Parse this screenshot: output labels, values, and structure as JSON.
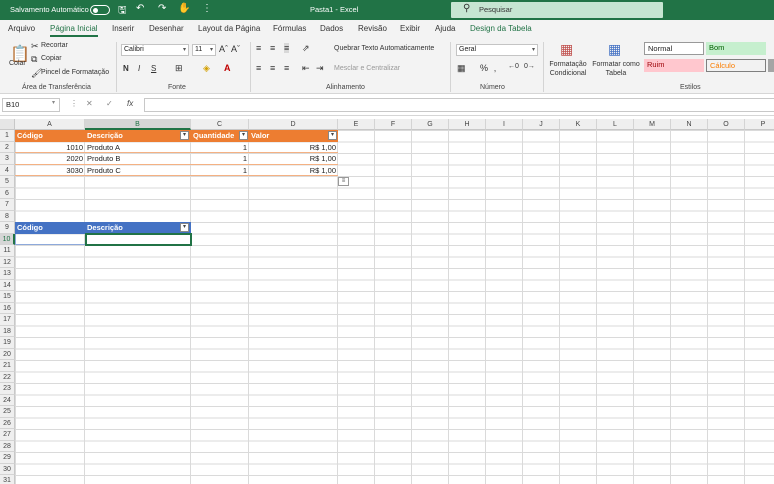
{
  "titlebar": {
    "autosave_label": "Salvamento Automático",
    "doc_title": "Pasta1  -  Excel",
    "search_placeholder": "Pesquisar",
    "accent": "#217346"
  },
  "tabs": [
    "Arquivo",
    "Página Inicial",
    "Inserir",
    "Desenhar",
    "Layout da Página",
    "Fórmulas",
    "Dados",
    "Revisão",
    "Exibir",
    "Ajuda",
    "Design da Tabela"
  ],
  "active_tab": "Página Inicial",
  "ribbon": {
    "clipboard": {
      "paste": "Colar",
      "cut": "Recortar",
      "copy": "Copiar",
      "format_painter": "Pincel de Formatação",
      "label": "Área de Transferência"
    },
    "font": {
      "name": "Calibri",
      "size": "11",
      "bold": "N",
      "italic": "I",
      "underline": "S",
      "label": "Fonte"
    },
    "alignment": {
      "wrap": "Quebrar Texto Automaticamente",
      "merge": "Mesclar e Centralizar",
      "label": "Alinhamento"
    },
    "number": {
      "format": "Geral",
      "percent": "%",
      "label": "Número"
    },
    "styles": {
      "conditional": "Formatação Condicional",
      "as_table": "Formatar como Tabela",
      "normal": "Normal",
      "bom": "Bom",
      "ruim": "Ruim",
      "calculo": "Cálculo",
      "label": "Estilos"
    }
  },
  "formula_bar": {
    "name_box": "B10",
    "fx": "fx",
    "value": ""
  },
  "columns": [
    "A",
    "B",
    "C",
    "D",
    "E",
    "F",
    "G",
    "H",
    "I",
    "J",
    "K",
    "L",
    "M",
    "N",
    "O",
    "P"
  ],
  "selected_column": "B",
  "rows": [
    "1",
    "2",
    "3",
    "4",
    "5",
    "6",
    "7",
    "8",
    "9",
    "10",
    "11",
    "12",
    "13",
    "14",
    "15",
    "16",
    "17",
    "18",
    "19",
    "20",
    "21",
    "22",
    "23",
    "24",
    "25",
    "26",
    "27",
    "28",
    "29",
    "30",
    "31"
  ],
  "selected_row": "10",
  "table1": {
    "headers": [
      "Código",
      "Descrição",
      "Quantidade",
      "Valor"
    ],
    "rows": [
      [
        "1010",
        "Produto A",
        "1",
        "R$ 1,00"
      ],
      [
        "2020",
        "Produto B",
        "1",
        "R$ 1,00"
      ],
      [
        "3030",
        "Produto C",
        "1",
        "R$ 1,00"
      ]
    ],
    "color": "#ed7d31"
  },
  "table2": {
    "headers": [
      "Código",
      "Descrição"
    ],
    "color": "#4472c4"
  }
}
